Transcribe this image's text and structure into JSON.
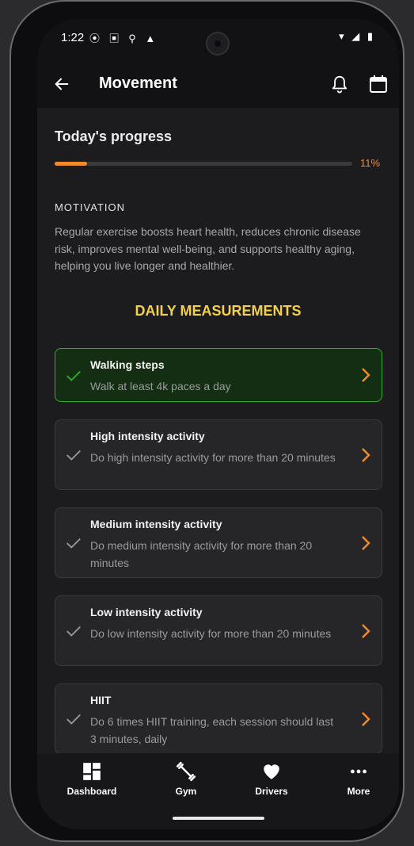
{
  "status": {
    "time": "1:22",
    "left_icons": "⦿ ▣ ⚲ ▲",
    "right_icons": "▾ ◢ ▮"
  },
  "appbar": {
    "title": "Movement"
  },
  "progress": {
    "title": "Today's progress",
    "percent_label": "11%",
    "percent_value": 11
  },
  "motivation": {
    "label": "MOTIVATION",
    "text": "Regular exercise boosts heart health, reduces chronic disease risk, improves mental well-being, and supports healthy aging, helping you live longer and healthier."
  },
  "measurements": {
    "heading": "DAILY MEASUREMENTS",
    "items": [
      {
        "title": "Walking steps",
        "desc": "Walk at least 4k paces a day",
        "done": true
      },
      {
        "title": "High intensity activity",
        "desc": "Do high intensity activity for more than 20 minutes",
        "done": false
      },
      {
        "title": "Medium intensity activity",
        "desc": "Do medium intensity activity for more than 20 minutes",
        "done": false
      },
      {
        "title": "Low intensity activity",
        "desc": "Do low intensity activity for more than 20 minutes",
        "done": false
      },
      {
        "title": "HIIT",
        "desc": "Do 6 times HIIT training, each session should last 3 minutes, daily",
        "done": false
      }
    ]
  },
  "nav": {
    "items": [
      {
        "label": "Dashboard",
        "icon": "dashboard-icon"
      },
      {
        "label": "Gym",
        "icon": "dumbbell-icon"
      },
      {
        "label": "Drivers",
        "icon": "heart-icon"
      },
      {
        "label": "More",
        "icon": "more-icon"
      }
    ]
  },
  "colors": {
    "accent": "#f28c2b",
    "heading": "#f2d04a",
    "success": "#2fae2a"
  }
}
